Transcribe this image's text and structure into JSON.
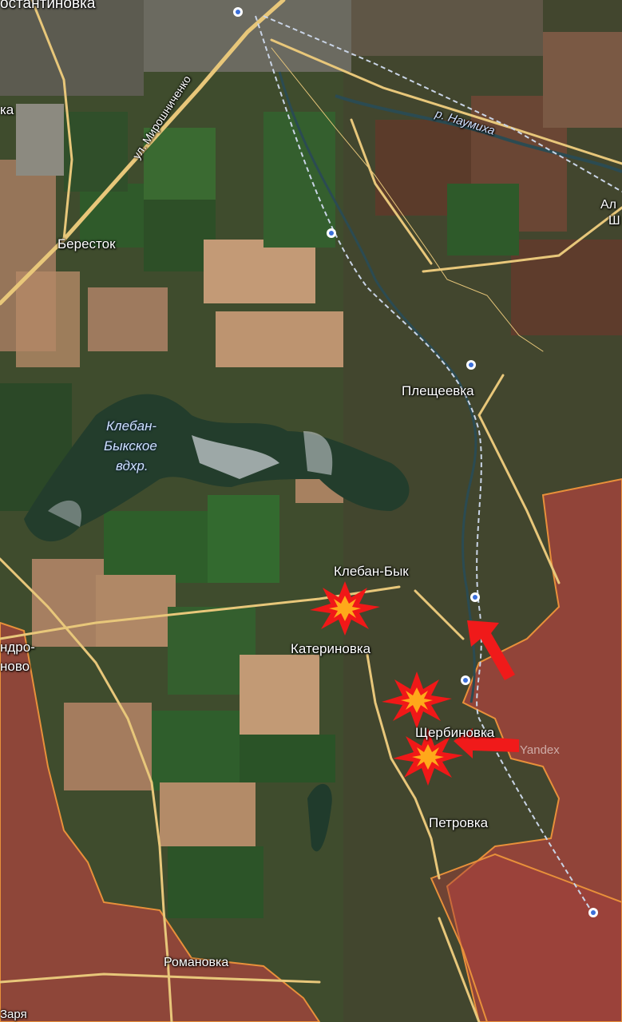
{
  "map": {
    "settlements": {
      "konstantinovka": "остантиновка",
      "berestok": "Бересток",
      "pleshcheevka": "Плещеевка",
      "kleban_byk": "Клебан-Бык",
      "katerinovka": "Катериновка",
      "shcherbinovka": "Щербиновка",
      "petrovka": "Петровка",
      "romanovka": "Романовка",
      "aleksandro_kalinovo_a": "ндро-",
      "aleksandro_kalinovo_b": "ново",
      "zarya": "Заря",
      "left_edge_fragment": "ка",
      "right_edge_fragment_a": "Ал",
      "right_edge_fragment_b": "Ш"
    },
    "water": {
      "reservoir_line1": "Клебан-",
      "reservoir_line2": "Быкское",
      "reservoir_line3": "вдхр.",
      "river": "р. Наумиха"
    },
    "streets": {
      "mironchenko": "ул. Мирошниченко"
    },
    "watermark": "Yandex",
    "colors": {
      "occupied_fill": "#b0443f",
      "occupied_border": "#e8903a",
      "road": "#e8c77a",
      "rail": "#c9d4e6",
      "explosion_outer": "#f01818",
      "explosion_inner": "#ffa81a",
      "arrow": "#f01a1a"
    },
    "markers": {
      "explosion_count": 3,
      "arrow_count": 2
    }
  }
}
